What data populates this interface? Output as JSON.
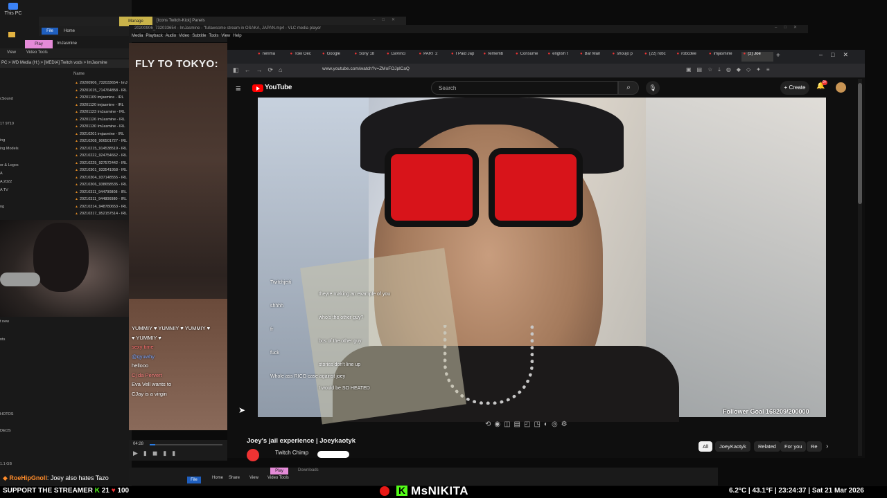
{
  "desktop": {
    "this_pc": "This PC"
  },
  "explorer": {
    "title": "[Icons Twitch-Kick] Panels",
    "manage": "Manage",
    "ribbon_file": "File",
    "ribbon_home": "Home",
    "play_tab": "Play",
    "imjasmine": "ImJasmine",
    "view": "View",
    "video_tools": "Video Tools",
    "path": "PC > WD Media (H:) > [MEDIA] Twitch vods > ImJasmine",
    "name_col": "Name",
    "files": [
      "20200906_732033654 - ImJ",
      "20201015_714764858 - IRL",
      "20201109 imjasmine - IRL",
      "20201120 imjasmine - IRL",
      "20201123 ImJasmine - IRL",
      "20201126 ImJasmine - IRL",
      "20201130 ImJasmine - IRL",
      "20210201 imjasmine - IRL",
      "20210208_906501727 - IRL",
      "20210215_914538519 - IRL",
      "20210222_924754662 - IRL",
      "20210225_927572442 - IRL",
      "20210301_933541958 - IRL",
      "20210304_937148555 - IRL",
      "20210306_938658535 - IRL",
      "20210311_944790808 - IRL",
      "20210311_944806980 - IRL",
      "20210314_948780653 - IRL",
      "20210317_952157514 - IRL"
    ],
    "sidebar": [
      "cSound",
      "17 9710",
      "ing",
      "ing Models",
      "or & Logos",
      "A",
      "A 2022",
      "A TV",
      "ng",
      "t new",
      "nts",
      "HOTOS",
      "DEOS"
    ],
    "status_bar": "1.1 GB"
  },
  "vlc": {
    "title": "20200906_732033654 - ImJasmine - \"fullawsome stream in OSAKA, JAPAN.mp4 - VLC media player",
    "menu": [
      "Media",
      "Playback",
      "Audio",
      "Video",
      "Subtitle",
      "Tools",
      "View",
      "Help"
    ],
    "overlay_text": "FLY TO TOKYO:",
    "time": "04:28"
  },
  "stream_chat": [
    {
      "text": "YUMMIY ♥ YUMMIY ♥ YUMMIY ♥",
      "color": "#ffffff"
    },
    {
      "text": "♥ YUMMIY ♥",
      "color": "#ffffff"
    },
    {
      "text": "sexy time",
      "color": "#ff7070"
    },
    {
      "text": "@qyuwhy",
      "color": "#7aa7ff"
    },
    {
      "text": "hellooo",
      "color": "#ffffff"
    },
    {
      "text": "Cj da Pervert",
      "color": "#ff8080"
    },
    {
      "text": "Eva Vell wants to",
      "color": "#ffffff"
    },
    {
      "text": "CJay is a virgin",
      "color": "#ffffff"
    }
  ],
  "browser": {
    "tabs": [
      "nerima",
      "Toei Oec",
      "Google",
      "Sony 18",
      "DaVinci",
      "PART 2",
      "I Paid Jap",
      "rememb",
      "Consume",
      "english t",
      "Bar Mari",
      "shoujo p",
      "(22) robc",
      "robcdee",
      "imjasmine",
      "(2) Joe"
    ],
    "url": "www.youtube.com/watch?v=ZMoFOJplCaQ"
  },
  "youtube": {
    "logo": "YouTube",
    "search_placeholder": "Search",
    "create": "Create",
    "notifications": "9+",
    "video_title": "Joey's jail experience | Joeykaotyk",
    "channel": "Twitch Chimp",
    "chips": [
      "All",
      "JoeyKaotyk",
      "Related",
      "For you",
      "Re"
    ],
    "follower_goal": "Follower Goal 168209/200000",
    "in_video_chat": [
      "Twitchjeiti",
      "theyre making an example of you",
      "shhhh",
      "who's the other guy?",
      "fr",
      "bcs of the other guy",
      "fuck",
      "stories don't line up",
      "Whole ass RICO case against joey",
      "I would be SO HEATED"
    ]
  },
  "bottom_explorer": {
    "play": "Play",
    "downloads": "Downloads",
    "file": "File",
    "home": "Home",
    "share": "Share",
    "view": "View",
    "video_tools": "Video Tools"
  },
  "overlay": {
    "chat_user": "RoeHipGnoll",
    "chat_message": ": Joey also hates Tazo",
    "support": "SUPPORT THE STREAMER",
    "support_count": "21",
    "support_count2": "100",
    "streamer_name": "MsNIKITA",
    "temp_c": "6.2°C",
    "temp_f": "43.1°F",
    "clock": "23:24:37",
    "date": "Sat 21 Mar 2026"
  }
}
